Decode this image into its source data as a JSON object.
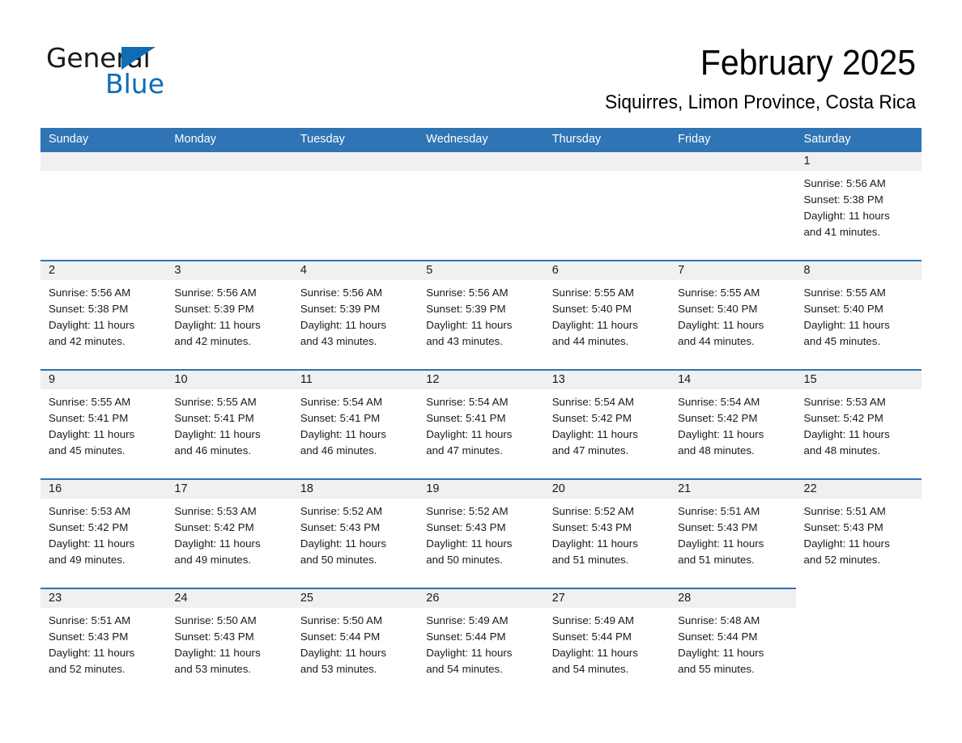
{
  "brand": {
    "name_part1": "General",
    "name_part2": "Blue",
    "accent_color": "#0f6cb5"
  },
  "header": {
    "title": "February 2025",
    "subtitle": "Siquirres, Limon Province, Costa Rica"
  },
  "theme": {
    "header_blue": "#2f74b5",
    "daynum_band": "#f0f0f0",
    "text": "#1a1a1a"
  },
  "weekdays": [
    "Sunday",
    "Monday",
    "Tuesday",
    "Wednesday",
    "Thursday",
    "Friday",
    "Saturday"
  ],
  "weeks": [
    [
      {
        "day": "",
        "blank": true
      },
      {
        "day": "",
        "blank": true
      },
      {
        "day": "",
        "blank": true
      },
      {
        "day": "",
        "blank": true
      },
      {
        "day": "",
        "blank": true
      },
      {
        "day": "",
        "blank": true
      },
      {
        "day": "1",
        "sunrise": "Sunrise: 5:56 AM",
        "sunset": "Sunset: 5:38 PM",
        "daylight1": "Daylight: 11 hours",
        "daylight2": "and 41 minutes."
      }
    ],
    [
      {
        "day": "2",
        "sunrise": "Sunrise: 5:56 AM",
        "sunset": "Sunset: 5:38 PM",
        "daylight1": "Daylight: 11 hours",
        "daylight2": "and 42 minutes."
      },
      {
        "day": "3",
        "sunrise": "Sunrise: 5:56 AM",
        "sunset": "Sunset: 5:39 PM",
        "daylight1": "Daylight: 11 hours",
        "daylight2": "and 42 minutes."
      },
      {
        "day": "4",
        "sunrise": "Sunrise: 5:56 AM",
        "sunset": "Sunset: 5:39 PM",
        "daylight1": "Daylight: 11 hours",
        "daylight2": "and 43 minutes."
      },
      {
        "day": "5",
        "sunrise": "Sunrise: 5:56 AM",
        "sunset": "Sunset: 5:39 PM",
        "daylight1": "Daylight: 11 hours",
        "daylight2": "and 43 minutes."
      },
      {
        "day": "6",
        "sunrise": "Sunrise: 5:55 AM",
        "sunset": "Sunset: 5:40 PM",
        "daylight1": "Daylight: 11 hours",
        "daylight2": "and 44 minutes."
      },
      {
        "day": "7",
        "sunrise": "Sunrise: 5:55 AM",
        "sunset": "Sunset: 5:40 PM",
        "daylight1": "Daylight: 11 hours",
        "daylight2": "and 44 minutes."
      },
      {
        "day": "8",
        "sunrise": "Sunrise: 5:55 AM",
        "sunset": "Sunset: 5:40 PM",
        "daylight1": "Daylight: 11 hours",
        "daylight2": "and 45 minutes."
      }
    ],
    [
      {
        "day": "9",
        "sunrise": "Sunrise: 5:55 AM",
        "sunset": "Sunset: 5:41 PM",
        "daylight1": "Daylight: 11 hours",
        "daylight2": "and 45 minutes."
      },
      {
        "day": "10",
        "sunrise": "Sunrise: 5:55 AM",
        "sunset": "Sunset: 5:41 PM",
        "daylight1": "Daylight: 11 hours",
        "daylight2": "and 46 minutes."
      },
      {
        "day": "11",
        "sunrise": "Sunrise: 5:54 AM",
        "sunset": "Sunset: 5:41 PM",
        "daylight1": "Daylight: 11 hours",
        "daylight2": "and 46 minutes."
      },
      {
        "day": "12",
        "sunrise": "Sunrise: 5:54 AM",
        "sunset": "Sunset: 5:41 PM",
        "daylight1": "Daylight: 11 hours",
        "daylight2": "and 47 minutes."
      },
      {
        "day": "13",
        "sunrise": "Sunrise: 5:54 AM",
        "sunset": "Sunset: 5:42 PM",
        "daylight1": "Daylight: 11 hours",
        "daylight2": "and 47 minutes."
      },
      {
        "day": "14",
        "sunrise": "Sunrise: 5:54 AM",
        "sunset": "Sunset: 5:42 PM",
        "daylight1": "Daylight: 11 hours",
        "daylight2": "and 48 minutes."
      },
      {
        "day": "15",
        "sunrise": "Sunrise: 5:53 AM",
        "sunset": "Sunset: 5:42 PM",
        "daylight1": "Daylight: 11 hours",
        "daylight2": "and 48 minutes."
      }
    ],
    [
      {
        "day": "16",
        "sunrise": "Sunrise: 5:53 AM",
        "sunset": "Sunset: 5:42 PM",
        "daylight1": "Daylight: 11 hours",
        "daylight2": "and 49 minutes."
      },
      {
        "day": "17",
        "sunrise": "Sunrise: 5:53 AM",
        "sunset": "Sunset: 5:42 PM",
        "daylight1": "Daylight: 11 hours",
        "daylight2": "and 49 minutes."
      },
      {
        "day": "18",
        "sunrise": "Sunrise: 5:52 AM",
        "sunset": "Sunset: 5:43 PM",
        "daylight1": "Daylight: 11 hours",
        "daylight2": "and 50 minutes."
      },
      {
        "day": "19",
        "sunrise": "Sunrise: 5:52 AM",
        "sunset": "Sunset: 5:43 PM",
        "daylight1": "Daylight: 11 hours",
        "daylight2": "and 50 minutes."
      },
      {
        "day": "20",
        "sunrise": "Sunrise: 5:52 AM",
        "sunset": "Sunset: 5:43 PM",
        "daylight1": "Daylight: 11 hours",
        "daylight2": "and 51 minutes."
      },
      {
        "day": "21",
        "sunrise": "Sunrise: 5:51 AM",
        "sunset": "Sunset: 5:43 PM",
        "daylight1": "Daylight: 11 hours",
        "daylight2": "and 51 minutes."
      },
      {
        "day": "22",
        "sunrise": "Sunrise: 5:51 AM",
        "sunset": "Sunset: 5:43 PM",
        "daylight1": "Daylight: 11 hours",
        "daylight2": "and 52 minutes."
      }
    ],
    [
      {
        "day": "23",
        "sunrise": "Sunrise: 5:51 AM",
        "sunset": "Sunset: 5:43 PM",
        "daylight1": "Daylight: 11 hours",
        "daylight2": "and 52 minutes."
      },
      {
        "day": "24",
        "sunrise": "Sunrise: 5:50 AM",
        "sunset": "Sunset: 5:43 PM",
        "daylight1": "Daylight: 11 hours",
        "daylight2": "and 53 minutes."
      },
      {
        "day": "25",
        "sunrise": "Sunrise: 5:50 AM",
        "sunset": "Sunset: 5:44 PM",
        "daylight1": "Daylight: 11 hours",
        "daylight2": "and 53 minutes."
      },
      {
        "day": "26",
        "sunrise": "Sunrise: 5:49 AM",
        "sunset": "Sunset: 5:44 PM",
        "daylight1": "Daylight: 11 hours",
        "daylight2": "and 54 minutes."
      },
      {
        "day": "27",
        "sunrise": "Sunrise: 5:49 AM",
        "sunset": "Sunset: 5:44 PM",
        "daylight1": "Daylight: 11 hours",
        "daylight2": "and 54 minutes."
      },
      {
        "day": "28",
        "sunrise": "Sunrise: 5:48 AM",
        "sunset": "Sunset: 5:44 PM",
        "daylight1": "Daylight: 11 hours",
        "daylight2": "and 55 minutes."
      },
      {
        "day": "",
        "void": true
      }
    ]
  ]
}
